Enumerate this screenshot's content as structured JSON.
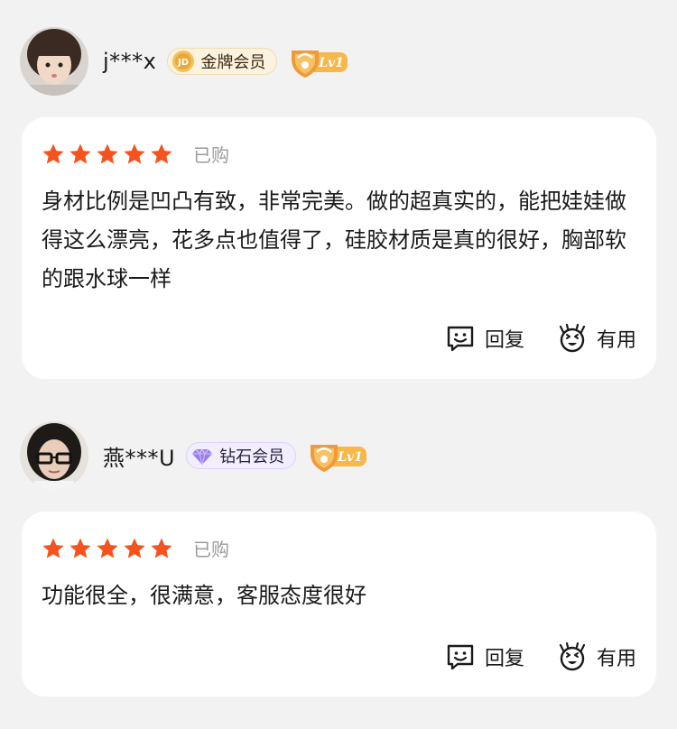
{
  "reviews": [
    {
      "username": "j***x",
      "membership": "金牌会员",
      "membership_icon": "jd-gold-icon",
      "level": "Lv1",
      "purchased_label": "已购",
      "rating": 5,
      "text": "身材比例是凹凸有致，非常完美。做的超真实的，能把娃娃做得这么漂亮，花多点也值得了，硅胶材质是真的很好，胸部软的跟水球一样",
      "reply_label": "回复",
      "useful_label": "有用"
    },
    {
      "username": "燕***U",
      "membership": "钻石会员",
      "membership_icon": "diamond-icon",
      "level": "Lv1",
      "purchased_label": "已购",
      "rating": 5,
      "text": "功能很全，很满意，客服态度很好",
      "reply_label": "回复",
      "useful_label": "有用"
    }
  ],
  "colors": {
    "star": "#f5521e",
    "gold_badge_bg": "#fbf2df",
    "diamond_badge_bg": "#f3eefe",
    "level_badge": "#f5a623",
    "page_bg": "#f2f2f2",
    "card_bg": "#ffffff"
  }
}
